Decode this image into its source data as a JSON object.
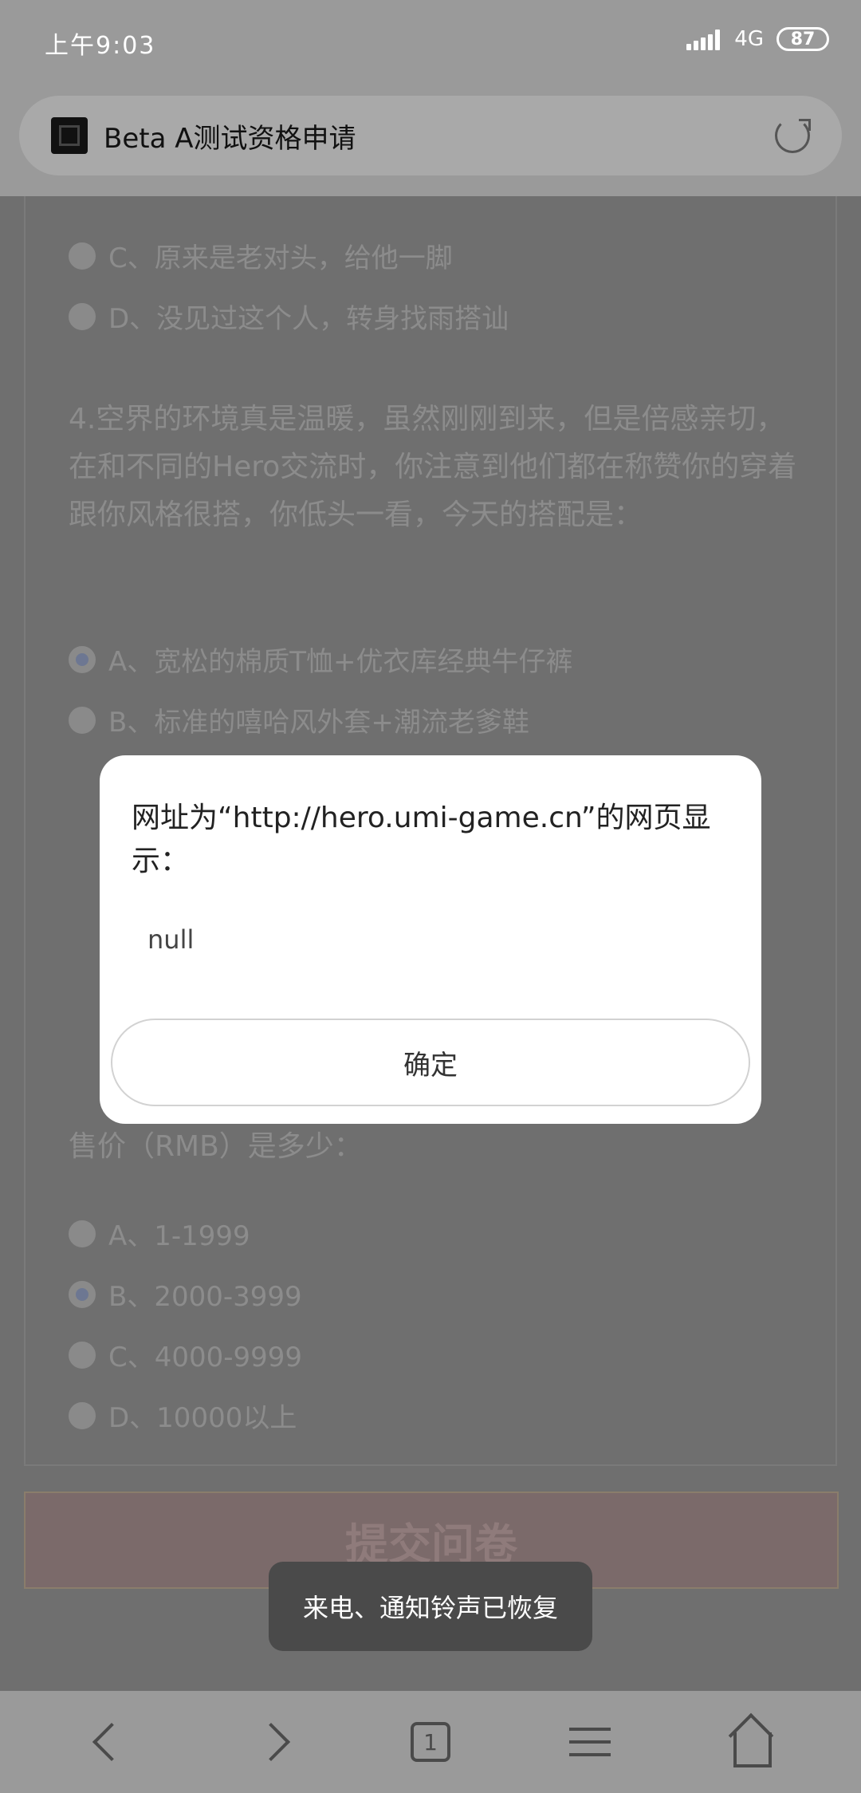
{
  "status_bar": {
    "time": "上午9:03",
    "network": "4G",
    "battery": "87"
  },
  "browser": {
    "page_title": "Beta A测试资格申请",
    "favicon": "site-favicon",
    "reload_icon": "reload-icon"
  },
  "page": {
    "q3_options": [
      {
        "label": "C、原来是老对头，给他一脚"
      },
      {
        "label": "D、没见过这个人，转身找雨搭讪"
      }
    ],
    "q4_text": "4.空界的环境真是温暖，虽然刚刚到来，但是倍感亲切，在和不同的Hero交流时，你注意到他们都在称赞你的穿着跟你风格很搭，你低头一看，今天的搭配是：",
    "q4_options": [
      {
        "label": "A、宽松的棉质T恤+优衣库经典牛仔裤",
        "checked": true
      },
      {
        "label": "B、标准的嘻哈风外套+潮流老爹鞋",
        "checked": false
      }
    ],
    "q5_tail": "售价（RMB）是多少：",
    "q5_options": [
      {
        "label": "A、1-1999",
        "checked": false
      },
      {
        "label": "B、2000-3999",
        "checked": true
      },
      {
        "label": "C、4000-9999",
        "checked": false
      },
      {
        "label": "D、10000以上",
        "checked": false
      }
    ],
    "submit_label": "提交问卷"
  },
  "dialog": {
    "title": "网址为“http://hero.umi-game.cn”的网页显示：",
    "message": "null",
    "ok_label": "确定"
  },
  "toast": {
    "text": "来电、通知铃声已恢复"
  },
  "bottom_nav": {
    "tab_count": "1"
  }
}
